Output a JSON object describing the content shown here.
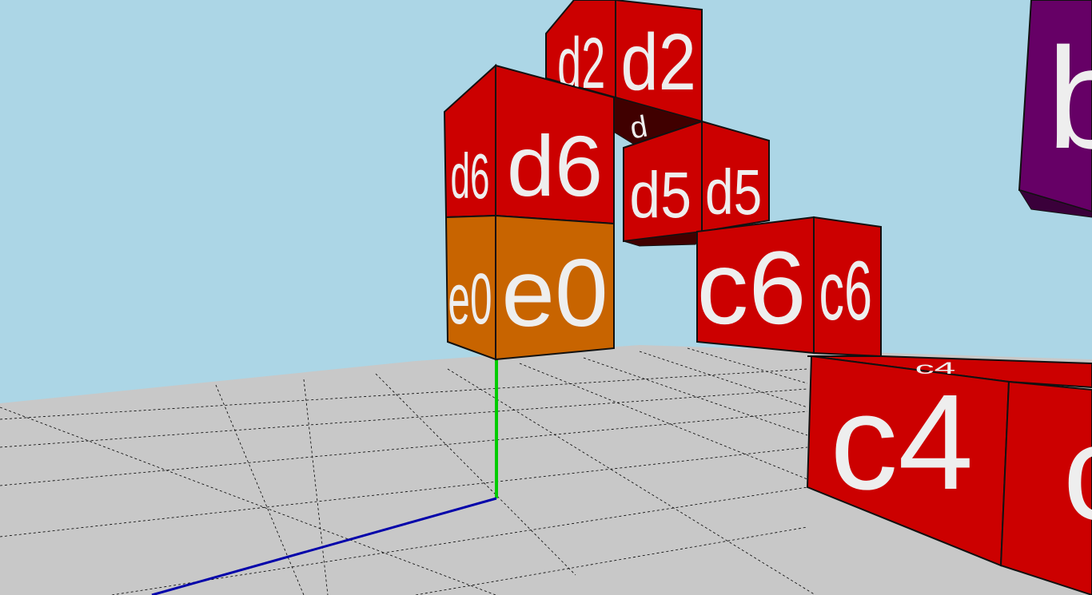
{
  "scene": {
    "sky_color": "#acd6e6",
    "floor_color": "#c8c8c8",
    "floor_line_color": "#000000",
    "axis_colors": {
      "y_axis": "#00cc00",
      "z_axis": "#0000aa"
    },
    "block_colors": {
      "d": "#cc0000",
      "c": "#cc0000",
      "e": "#c86400",
      "top_right": "#660066"
    }
  },
  "blocks": {
    "d2": "d2",
    "d6": "d6",
    "d5": "d5",
    "e0": "e0",
    "c6": "c6",
    "c4": "c4",
    "c_partial": "c",
    "b_partial": "b",
    "d_partial_underside": "d",
    "c4_top": "c4"
  }
}
